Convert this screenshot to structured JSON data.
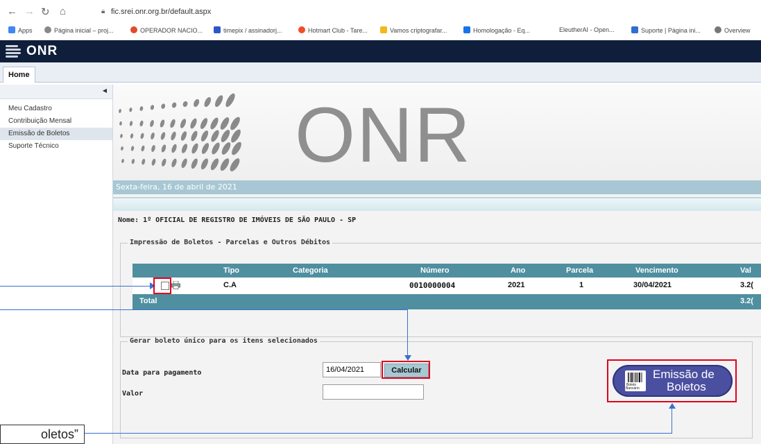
{
  "browser": {
    "url": "fic.srei.onr.org.br/default.aspx",
    "bookmarks": [
      {
        "label": "Apps",
        "color": "#4285f4"
      },
      {
        "label": "Página inicial – proj...",
        "color": "#888888"
      },
      {
        "label": "OPERADOR NACIO...",
        "color": "#e34a2d"
      },
      {
        "label": "timepix / assinadorj...",
        "color": "#2b58c9"
      },
      {
        "label": "Hotmart Club - Tare...",
        "color": "#f04e23"
      },
      {
        "label": "Vamos criptografar...",
        "color": "#f1b91a"
      },
      {
        "label": "Homologação - Eq...",
        "color": "#1a73e8"
      },
      {
        "label": "EleutherAI - Open...",
        "color": "#ffffff"
      },
      {
        "label": "Suporte | Página ini...",
        "color": "#2f6fcf"
      },
      {
        "label": "Overview",
        "color": "#777777"
      }
    ]
  },
  "app": {
    "logo": "ONR",
    "tab": "Home"
  },
  "sidebar": {
    "items": [
      "Meu Cadastro",
      "Contribuição Mensal",
      "Emissão de Boletos",
      "Suporte Técnico"
    ]
  },
  "banner": {
    "brand": "ONR",
    "date": "Sexta-feira, 16 de abril de 2021"
  },
  "main": {
    "nome": "Nome: 1º OFICIAL DE REGISTRO DE IMÓVEIS DE SÃO PAULO - SP",
    "section1": "Impressão de Boletos - Parcelas e Outros Débitos",
    "grid": {
      "headers": [
        "Tipo",
        "Categoria",
        "Número",
        "Ano",
        "Parcela",
        "Vencimento",
        "Val"
      ],
      "row": {
        "tipo": "C.A",
        "categoria": "",
        "numero": "0010000004",
        "ano": "2021",
        "parcela": "1",
        "vencimento": "30/04/2021",
        "valor": "3.2("
      },
      "total_label": "Total",
      "total_value": "3.2("
    },
    "section2": "Gerar boleto único para os itens selecionados",
    "data_label": "Data para pagamento",
    "data_value": "16/04/2021",
    "calc_button": "Calcular",
    "valor_label": "Valor",
    "valor_value": "",
    "boleto_button": {
      "line1": "Emissão de",
      "line2": "Boletos",
      "badge1": "Boleto",
      "badge2": "Bancário"
    }
  },
  "annotation": {
    "callout": "oletos”",
    "color": "#3a6fd0"
  }
}
